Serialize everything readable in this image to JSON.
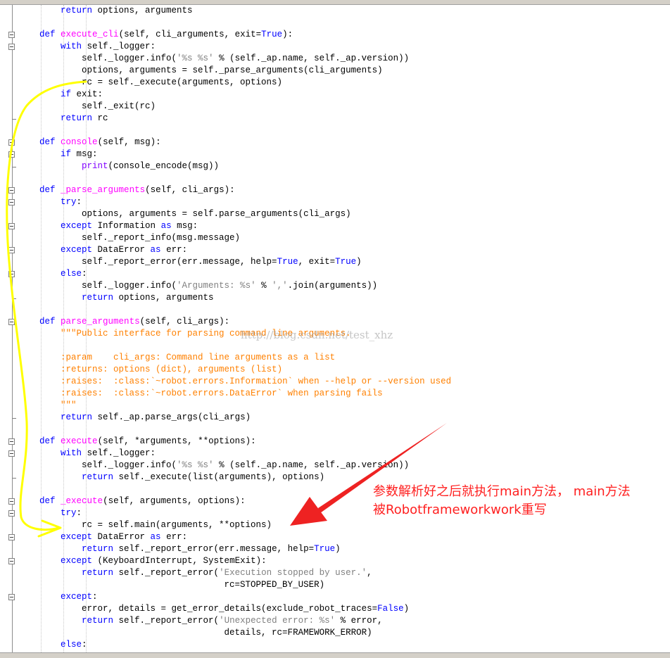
{
  "code_lines": [
    {
      "html": "        <span class=\"kw\">return</span> options, arguments"
    },
    {
      "html": ""
    },
    {
      "html": "    <span class=\"kw\">def</span> <span class=\"fn\">execute_cli</span>(self, cli_arguments, exit=<span class=\"kw\">True</span>):"
    },
    {
      "html": "        <span class=\"kw\">with</span> self._logger:"
    },
    {
      "html": "            self._logger.info(<span class=\"str\">'%s %s'</span> % (self._ap.name, self._ap.version))"
    },
    {
      "html": "            options, arguments = self._parse_arguments(cli_arguments)"
    },
    {
      "html": "            rc = self._execute(arguments, options)"
    },
    {
      "html": "        <span class=\"kw\">if</span> exit:"
    },
    {
      "html": "            self._exit(rc)"
    },
    {
      "html": "        <span class=\"kw\">return</span> rc"
    },
    {
      "html": ""
    },
    {
      "html": "    <span class=\"kw\">def</span> <span class=\"fn\">console</span>(self, msg):"
    },
    {
      "html": "        <span class=\"kw\">if</span> msg:"
    },
    {
      "html": "            <span class=\"bi\">print</span>(console_encode(msg))"
    },
    {
      "html": ""
    },
    {
      "html": "    <span class=\"kw\">def</span> <span class=\"fn\">_parse_arguments</span>(self, cli_args):"
    },
    {
      "html": "        <span class=\"kw\">try</span>:"
    },
    {
      "html": "            options, arguments = self.parse_arguments(cli_args)"
    },
    {
      "html": "        <span class=\"kw\">except</span> Information <span class=\"kw\">as</span> msg:"
    },
    {
      "html": "            self._report_info(msg.message)"
    },
    {
      "html": "        <span class=\"kw\">except</span> DataError <span class=\"kw\">as</span> err:"
    },
    {
      "html": "            self._report_error(err.message, help=<span class=\"kw\">True</span>, exit=<span class=\"kw\">True</span>)"
    },
    {
      "html": "        <span class=\"kw\">else</span>:"
    },
    {
      "html": "            self._logger.info(<span class=\"str\">'Arguments: %s'</span> % <span class=\"str\">','</span>.join(arguments))"
    },
    {
      "html": "            <span class=\"kw\">return</span> options, arguments"
    },
    {
      "html": ""
    },
    {
      "html": "    <span class=\"kw\">def</span> <span class=\"fn\">parse_arguments</span>(self, cli_args):"
    },
    {
      "html": "        <span class=\"doc\">\"\"\"Public interface for parsing command line arguments.</span>"
    },
    {
      "html": ""
    },
    {
      "html": "        <span class=\"doc\">:param    cli_args: Command line arguments as a list</span>"
    },
    {
      "html": "        <span class=\"doc\">:returns: options (dict), arguments (list)</span>"
    },
    {
      "html": "        <span class=\"doc\">:raises:  :class:`~robot.errors.Information` when --help or --version used</span>"
    },
    {
      "html": "        <span class=\"doc\">:raises:  :class:`~robot.errors.DataError` when parsing fails</span>"
    },
    {
      "html": "        <span class=\"doc\">\"\"\"</span>"
    },
    {
      "html": "        <span class=\"kw\">return</span> self._ap.parse_args(cli_args)"
    },
    {
      "html": ""
    },
    {
      "html": "    <span class=\"kw\">def</span> <span class=\"fn\">execute</span>(self, *arguments, **options):"
    },
    {
      "html": "        <span class=\"kw\">with</span> self._logger:"
    },
    {
      "html": "            self._logger.info(<span class=\"str\">'%s %s'</span> % (self._ap.name, self._ap.version))"
    },
    {
      "html": "            <span class=\"kw\">return</span> self._execute(list(arguments), options)"
    },
    {
      "html": ""
    },
    {
      "html": "    <span class=\"kw\">def</span> <span class=\"fn\">_execute</span>(self, arguments, options):"
    },
    {
      "html": "        <span class=\"kw\">try</span>:"
    },
    {
      "html": "            rc = self.main(arguments, **options)"
    },
    {
      "html": "        <span class=\"kw\">except</span> DataError <span class=\"kw\">as</span> err:"
    },
    {
      "html": "            <span class=\"kw\">return</span> self._report_error(err.message, help=<span class=\"kw\">True</span>)"
    },
    {
      "html": "        <span class=\"kw\">except</span> (KeyboardInterrupt, SystemExit):"
    },
    {
      "html": "            <span class=\"kw\">return</span> self._report_error(<span class=\"str\">'Execution stopped by user.'</span>,"
    },
    {
      "html": "                                       rc=STOPPED_BY_USER)"
    },
    {
      "html": "        <span class=\"kw\">except</span>:"
    },
    {
      "html": "            error, details = get_error_details(exclude_robot_traces=<span class=\"kw\">False</span>)"
    },
    {
      "html": "            <span class=\"kw\">return</span> self._report_error(<span class=\"str\">'Unexpected error: %s'</span> % error,"
    },
    {
      "html": "                                       details, rc=FRAMEWORK_ERROR)"
    },
    {
      "html": "        <span class=\"kw\">else</span>:"
    }
  ],
  "fold_starts": [
    2,
    3,
    11,
    12,
    15,
    16,
    18,
    20,
    22,
    26,
    36,
    37,
    41,
    42,
    44,
    46,
    49
  ],
  "fold_ends": [
    9,
    13,
    24,
    34,
    39
  ],
  "watermark": "http://blog.csdn.net/test_xhz",
  "annotation": {
    "line1": "参数解析好之后就执行main方法， main方法",
    "line2": "被Robotframeworkwork重写"
  },
  "colors": {
    "annotation": "#ff2020",
    "highlight_stroke": "#ffff00",
    "keyword": "#0000ff",
    "function": "#ff00ff",
    "docstring": "#ff8000"
  }
}
